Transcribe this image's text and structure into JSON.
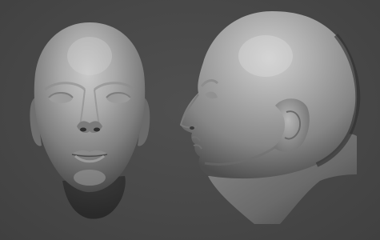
{
  "scene": {
    "views": [
      "front-view",
      "side-view"
    ]
  },
  "colors": {
    "background": "#4a4a4a",
    "clay_light": "#bdbdbd",
    "clay_mid": "#8f8f8f",
    "clay_dark": "#3a3a3a"
  }
}
